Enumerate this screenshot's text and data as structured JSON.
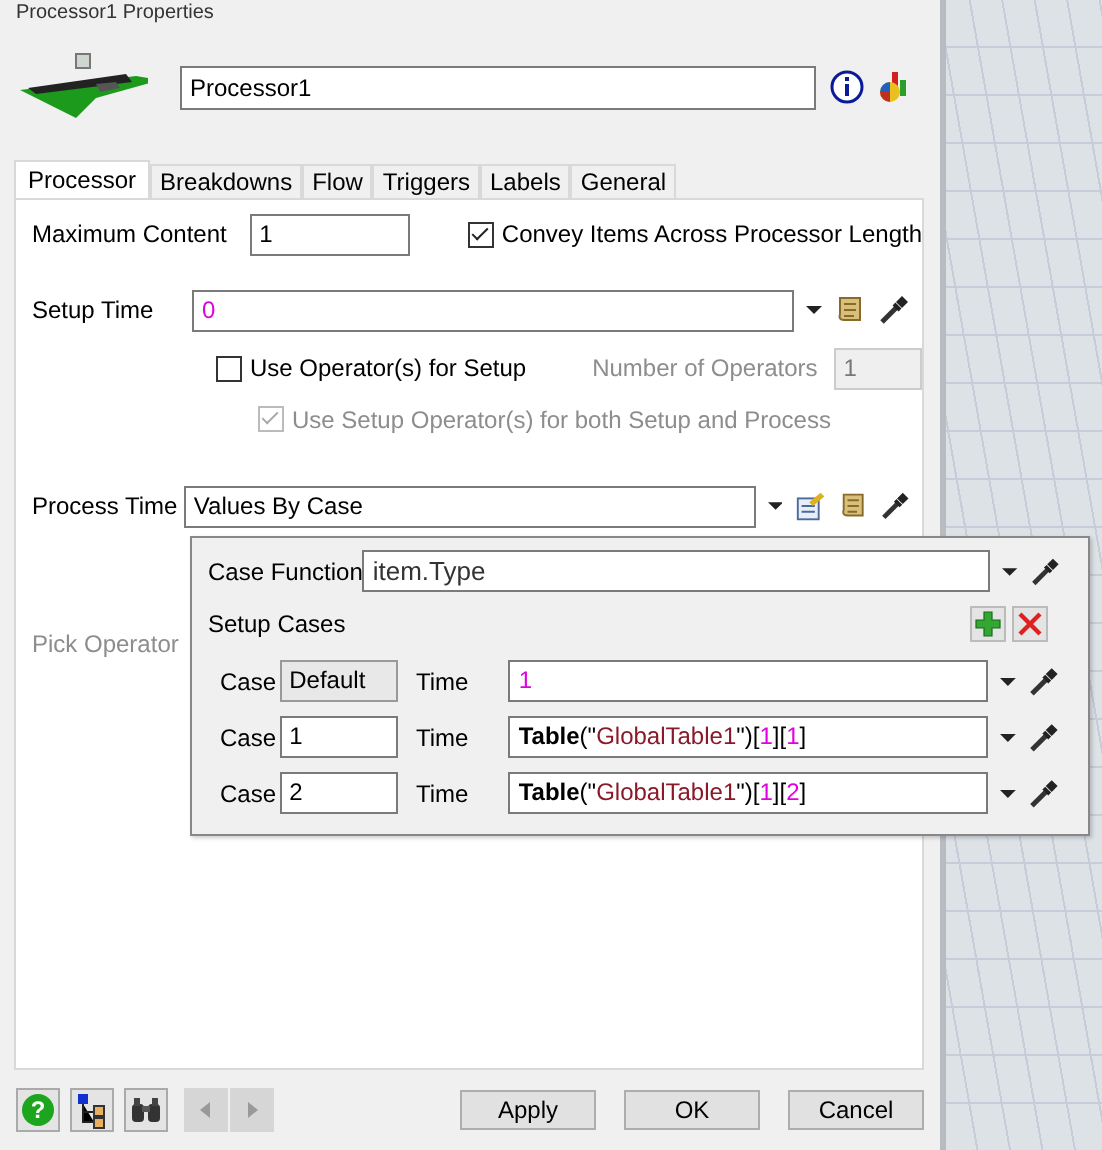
{
  "window": {
    "title": "Processor1 Properties"
  },
  "name_field": {
    "value": "Processor1"
  },
  "tabs": [
    {
      "label": "Processor",
      "selected": true
    },
    {
      "label": "Breakdowns",
      "selected": false
    },
    {
      "label": "Flow",
      "selected": false
    },
    {
      "label": "Triggers",
      "selected": false
    },
    {
      "label": "Labels",
      "selected": false
    },
    {
      "label": "General",
      "selected": false
    }
  ],
  "maximum_content": {
    "label": "Maximum Content",
    "value": "1"
  },
  "convey_items": {
    "label": "Convey Items Across Processor Length",
    "checked": true
  },
  "setup_time": {
    "label": "Setup Time",
    "tokens": [
      {
        "kind": "number",
        "text": "0"
      }
    ]
  },
  "use_operator_setup": {
    "label": "Use Operator(s) for Setup",
    "checked": false
  },
  "number_of_operators": {
    "label": "Number of Operators",
    "value": "1",
    "disabled": true
  },
  "use_setup_operator_both": {
    "label": "Use Setup Operator(s) for both Setup and Process",
    "checked": true,
    "disabled": true
  },
  "process_time": {
    "label": "Process Time",
    "value": "Values By Case"
  },
  "pick_operator": {
    "label": "Pick Operator",
    "disabled": true
  },
  "case_popup": {
    "case_function": {
      "label": "Case Function",
      "value": "item.Type"
    },
    "setup_cases_label": "Setup Cases",
    "cases": [
      {
        "case_label": "Case",
        "case": "Default",
        "case_disabled": true,
        "time_label": "Time",
        "tokens": [
          {
            "kind": "number",
            "text": "1"
          }
        ]
      },
      {
        "case_label": "Case",
        "case": "1",
        "case_disabled": false,
        "time_label": "Time",
        "tokens": [
          {
            "kind": "keyword",
            "text": "Table"
          },
          {
            "kind": "punct",
            "text": "(\""
          },
          {
            "kind": "string",
            "text": "GlobalTable1"
          },
          {
            "kind": "punct",
            "text": "\")["
          },
          {
            "kind": "number",
            "text": "1"
          },
          {
            "kind": "punct",
            "text": "]["
          },
          {
            "kind": "number",
            "text": "1"
          },
          {
            "kind": "punct",
            "text": "]"
          }
        ]
      },
      {
        "case_label": "Case",
        "case": "2",
        "case_disabled": false,
        "time_label": "Time",
        "tokens": [
          {
            "kind": "keyword",
            "text": "Table"
          },
          {
            "kind": "punct",
            "text": "(\""
          },
          {
            "kind": "string",
            "text": "GlobalTable1"
          },
          {
            "kind": "punct",
            "text": "\")["
          },
          {
            "kind": "number",
            "text": "1"
          },
          {
            "kind": "punct",
            "text": "]["
          },
          {
            "kind": "number",
            "text": "2"
          },
          {
            "kind": "punct",
            "text": "]"
          }
        ]
      }
    ]
  },
  "help_button": {
    "glyph": "?"
  },
  "nav": {
    "back_disabled": true,
    "forward_disabled": true
  },
  "buttons": [
    "Apply",
    "OK",
    "Cancel"
  ]
}
